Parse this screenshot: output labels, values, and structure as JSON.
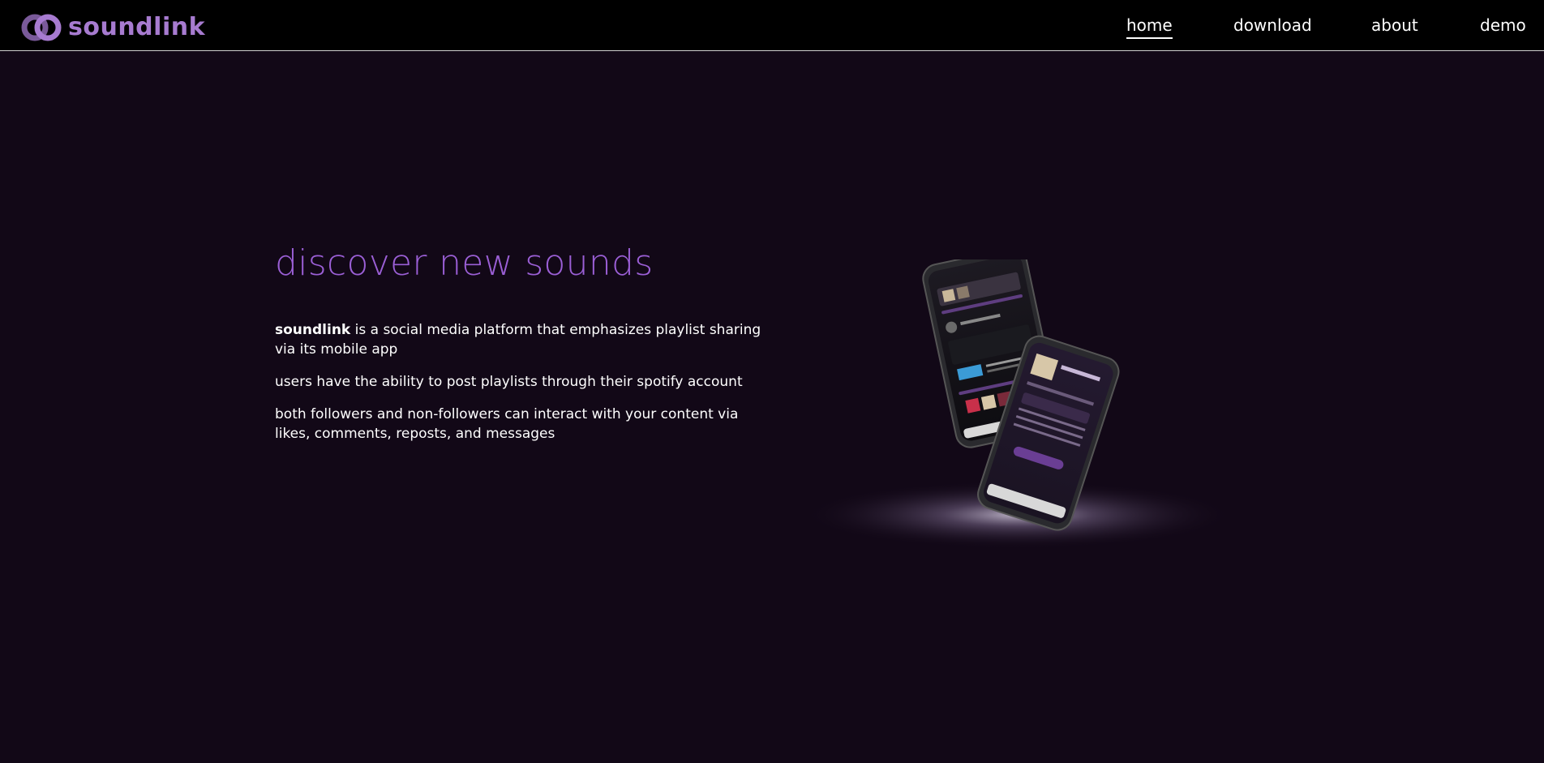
{
  "brand": {
    "name": "soundlink",
    "color": "#a77bd0"
  },
  "nav": {
    "items": [
      {
        "id": "home",
        "label": "home",
        "active": true
      },
      {
        "id": "download",
        "label": "download",
        "active": false
      },
      {
        "id": "about",
        "label": "about",
        "active": false
      },
      {
        "id": "demo",
        "label": "demo",
        "active": false
      }
    ]
  },
  "hero": {
    "headline": "discover new sounds",
    "headline_color": "#9b5fd6",
    "paragraphs": {
      "p1_brand": "soundlink",
      "p1_rest": " is a social media platform that emphasizes playlist sharing via its mobile app",
      "p2": "users have the ability to post playlists through their spotify account",
      "p3": "both followers and non-followers can interact with your content via likes, comments, reposts, and messages"
    }
  },
  "colors": {
    "page_background": "#120817",
    "navbar_background": "#000000",
    "text": "#ffffff"
  },
  "mockup": {
    "icon": "phone-mockup-image"
  }
}
